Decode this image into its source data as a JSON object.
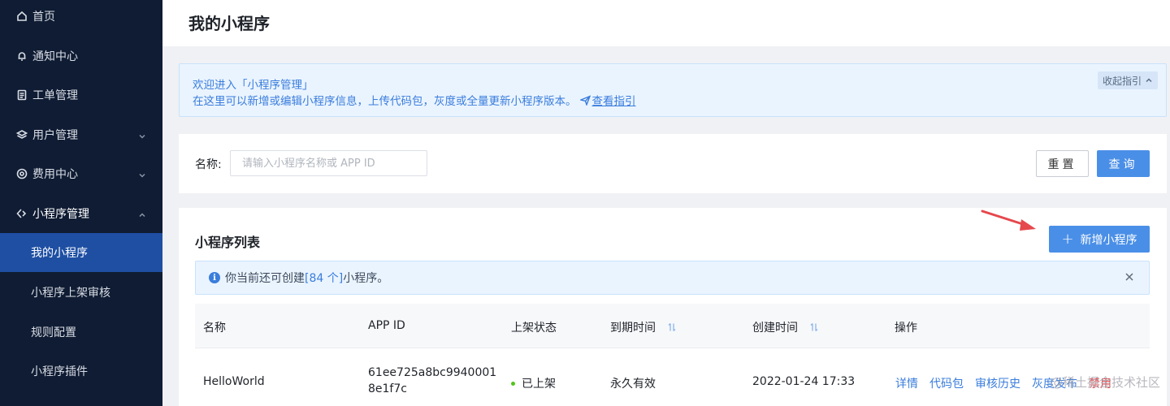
{
  "sidebar": {
    "items": [
      {
        "label": "首页",
        "icon": "home-icon"
      },
      {
        "label": "通知中心",
        "icon": "bell-icon"
      },
      {
        "label": "工单管理",
        "icon": "document-icon"
      },
      {
        "label": "用户管理",
        "icon": "layers-icon"
      },
      {
        "label": "费用中心",
        "icon": "coin-icon"
      },
      {
        "label": "小程序管理",
        "icon": "code-icon"
      }
    ],
    "sub_items": [
      {
        "label": "我的小程序"
      },
      {
        "label": "小程序上架审核"
      },
      {
        "label": "规则配置"
      },
      {
        "label": "小程序插件"
      }
    ],
    "colors": {
      "background": "#0f1c33",
      "active": "#1e4fa3"
    }
  },
  "header": {
    "title": "我的小程序"
  },
  "guide": {
    "line1": "欢迎进入「小程序管理」",
    "line2": "在这里可以新增或编辑小程序信息，上传代码包，灰度或全量更新小程序版本。",
    "link": "查看指引",
    "collapse": "收起指引"
  },
  "filter": {
    "label": "名称:",
    "placeholder": "请输入小程序名称或 APP ID",
    "value": "",
    "reset": "重置",
    "query": "查询"
  },
  "list": {
    "title": "小程序列表",
    "add_button": "新增小程序",
    "alert": {
      "prefix": "你当前还可创建",
      "count": "[84 个]",
      "suffix": "小程序。"
    },
    "columns": [
      "名称",
      "APP ID",
      "上架状态",
      "到期时间",
      "创建时间",
      "操作"
    ],
    "rows": [
      {
        "name": "HelloWorld",
        "app_id_line1": "61ee725a8bc9940001",
        "app_id_line2": "8e1f7c",
        "status": "已上架",
        "expire": "永久有效",
        "created": "2022-01-24 17:33",
        "actions": [
          "详情",
          "代码包",
          "审核历史",
          "灰度发布",
          "禁用"
        ]
      }
    ]
  },
  "watermark": "@稀土掘金技术社区",
  "colors": {
    "primary": "#4a8fe7",
    "link": "#3a7ddc",
    "danger": "#e5484d",
    "annotation_arrow": "#e5484d"
  }
}
